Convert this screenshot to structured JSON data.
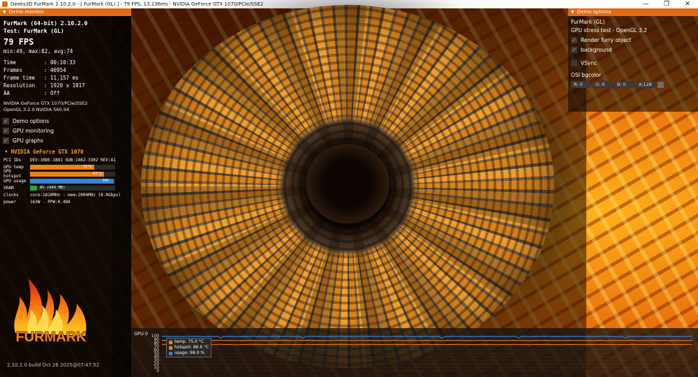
{
  "window": {
    "title": "Geeks3D FurMark 2.10.2.0 - [ FurMark (GL) ] - 79 FPS, 13.236ms - NVIDIA GeForce GTX 1070/PCIe/SSE2",
    "minimize": "—",
    "maximize": "❐",
    "close": "✕"
  },
  "demo_monitor": {
    "header": "Demo monitor",
    "app_line": "FurMark (64-bit) 2.10.2.0",
    "test_line": "Test: FurMark (GL)",
    "fps": "79 FPS",
    "minmax": "min:49, max:82, avg:74",
    "stats": [
      {
        "key": "Time",
        "value": ": 00:10:33"
      },
      {
        "key": "Frames",
        "value": ": 46954"
      },
      {
        "key": "Frame time",
        "value": ": 11.157 ms"
      },
      {
        "key": "Resolution",
        "value": ": 1920 x 1017"
      },
      {
        "key": "AA",
        "value": ": Off"
      }
    ],
    "renderer": "NVIDIA GeForce GTX 1070/PCIe/SSE2",
    "opengl": "OpenGL 3.2.0 NVIDIA 560.94",
    "options": [
      {
        "label": "Demo options",
        "checked": true
      },
      {
        "label": "GPU monitoring",
        "checked": true
      },
      {
        "label": "GPU graphs",
        "checked": true
      }
    ]
  },
  "gpu": {
    "name": "NVIDIA GeForce GTX 1070",
    "pci_label": "PCI IDs",
    "pci_value": "DEV:10DE-1B81 SUB:1462-3302 REV:A1",
    "temp_label": "GPU temp",
    "temp_text": "75°C",
    "temp_fraction": 0.75,
    "hotspot_label": "GPU hotspot",
    "hotspot_text": "87°C",
    "hotspot_fraction": 0.87,
    "usage_label": "GPU usage",
    "usage_text": "98%",
    "usage_fraction": 0.98,
    "vram_label": "VRAM",
    "vram_text": "8% (649 MB)",
    "vram_fraction": 0.08,
    "clocks_label": "Clocks",
    "clocks_value": "core:1810MHz - mem:2004MHz (8.0Gbps)",
    "power_label": "power",
    "power_value": "163W - PPW:0.484"
  },
  "logo_text": "FURMARK",
  "build": "2.10.2.0 build Oct 26 2025@07:47:52",
  "demo_options": {
    "header": "Demo options",
    "subtitle": "FurMark (GL)",
    "test": "GPU stress test - OpenGL 3.2",
    "options": [
      {
        "label": "Render furry object",
        "checked": true
      },
      {
        "label": "background",
        "checked": true
      },
      {
        "label": "VSync",
        "checked": false
      }
    ],
    "osi_label": "OSI bgcolor",
    "rgba": [
      "R: 0",
      "G: 0",
      "B: 0",
      "A:128"
    ]
  },
  "graph": {
    "title": "GPU 0",
    "y_ticks": [
      "100",
      "90",
      "80",
      "70",
      "60",
      "50",
      "40",
      "30",
      "20",
      "10",
      "0"
    ],
    "legend": [
      {
        "label": "temp. 75.0 °C",
        "color": "#e8821a"
      },
      {
        "label": "hotspot: 86.6 °C",
        "color": "#ee7a4e"
      },
      {
        "label": "usage: 98.0 %",
        "color": "#2e86d6"
      }
    ]
  },
  "colors": {
    "accent": "#e36a11",
    "temp": "#e8821a",
    "hotspot": "#ee7a4e",
    "usage": "#2e86d6",
    "vram": "#2ea043"
  }
}
